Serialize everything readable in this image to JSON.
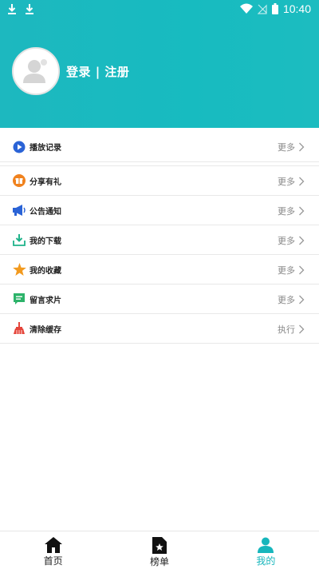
{
  "status_bar": {
    "time": "10:40"
  },
  "profile": {
    "login_label": "登录 | 注册"
  },
  "menu": {
    "history": {
      "label": "播放记录",
      "action": "更多"
    },
    "items": [
      {
        "label": "分享有礼",
        "action": "更多",
        "icon": "gift-icon",
        "color": "#f0821e"
      },
      {
        "label": "公告通知",
        "action": "更多",
        "icon": "megaphone-icon",
        "color": "#2a63d6"
      },
      {
        "label": "我的下载",
        "action": "更多",
        "icon": "download-icon",
        "color": "#1fb38a"
      },
      {
        "label": "我的收藏",
        "action": "更多",
        "icon": "star-icon",
        "color": "#f29a1f"
      },
      {
        "label": "留言求片",
        "action": "更多",
        "icon": "message-icon",
        "color": "#2db36a"
      },
      {
        "label": "清除缓存",
        "action": "执行",
        "icon": "broom-icon",
        "color": "#e5453b"
      }
    ]
  },
  "tabbar": {
    "tabs": [
      {
        "label": "首页",
        "icon": "home-icon"
      },
      {
        "label": "榜单",
        "icon": "ranking-icon"
      },
      {
        "label": "我的",
        "icon": "profile-icon",
        "active": true
      }
    ]
  },
  "colors": {
    "accent": "#17b6bc",
    "header": "#1cb9bf"
  }
}
